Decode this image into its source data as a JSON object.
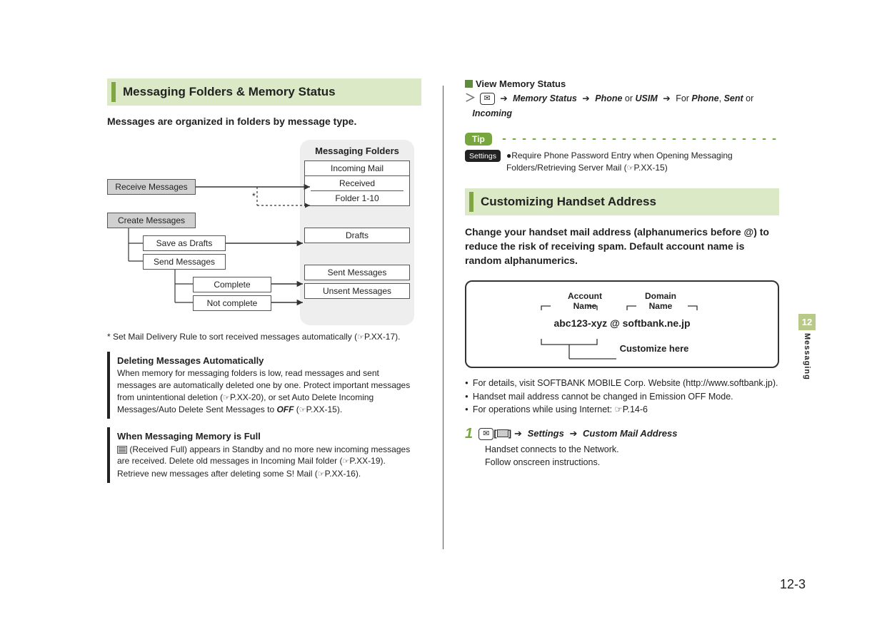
{
  "page_number": "12-3",
  "chapter_tab": {
    "number": "12",
    "label": "Messaging"
  },
  "left": {
    "heading": "Messaging Folders & Memory Status",
    "intro": "Messages are organized in folders by message type.",
    "diagram": {
      "folders_title": "Messaging Folders",
      "incoming_mail": "Incoming Mail",
      "received": "Received",
      "folder_range": "Folder 1-10",
      "drafts": "Drafts",
      "sent": "Sent Messages",
      "unsent": "Unsent Messages",
      "receive": "Receive Messages",
      "create": "Create Messages",
      "save_drafts": "Save as Drafts",
      "send": "Send Messages",
      "complete": "Complete",
      "not_complete": "Not complete",
      "asterisk": "*"
    },
    "footnote_prefix": "* Set Mail Delivery Rule to sort received messages automatically (",
    "footnote_ref": "P.XX-17",
    "footnote_suffix": ").",
    "note1": {
      "title": "Deleting Messages Automatically",
      "body_a": "When memory for messaging folders is low, read messages and sent messages are automatically deleted one by one. Protect important messages from unintentional deletion (",
      "ref1": "P.XX-20",
      "body_b": "), or set Auto Delete Incoming Messages/Auto Delete Sent Messages to ",
      "off": "OFF",
      "body_c": " (",
      "ref2": "P.XX-15",
      "body_d": ")."
    },
    "note2": {
      "title": "When Messaging Memory is Full",
      "body_a": " (Received Full) appears in Standby and no more new incoming messages are received. Delete old messages in Incoming Mail folder (",
      "ref1": "P.XX-19",
      "body_b": ").",
      "body_c": "Retrieve new messages after deleting some S! Mail (",
      "ref2": "P.XX-16",
      "body_d": ")."
    }
  },
  "right": {
    "view_memory_title": "View Memory Status",
    "vm_steps": {
      "memory_status": "Memory Status",
      "phone": "Phone",
      "or1": " or ",
      "usim": "USIM",
      "for_txt": " For ",
      "phone2": "Phone",
      "comma": ", ",
      "sent": "Sent",
      "or2": " or ",
      "incoming": "Incoming"
    },
    "tip_label": "Tip",
    "settings_label": "Settings",
    "settings_text_a": "●Require Phone Password Entry when Opening Messaging Folders/Retrieving Server Mail (",
    "settings_ref": "P.XX-15",
    "settings_text_b": ")",
    "heading2": "Customizing Handset Address",
    "intro2": "Change your handset mail address (alphanumerics before @) to reduce the risk of receiving spam. Default account name is random alphanumerics.",
    "addr": {
      "account_label": "Account\nName",
      "domain_label": "Domain\nName",
      "email_account": "abc123-xyz",
      "email_at": " @ ",
      "email_domain": "softbank.ne.jp",
      "customize": "Customize here"
    },
    "bullets": [
      "For details, visit SOFTBANK MOBILE Corp. Website (http://www.softbank.jp).",
      "Handset mail address cannot be changed in Emission OFF Mode.",
      "For operations while using Internet: ☞P.14-6"
    ],
    "step1": {
      "num": "1",
      "settings": "Settings",
      "custom": "Custom Mail Address",
      "note_a": "Handset connects to the Network.",
      "note_b": "Follow onscreen instructions."
    }
  }
}
